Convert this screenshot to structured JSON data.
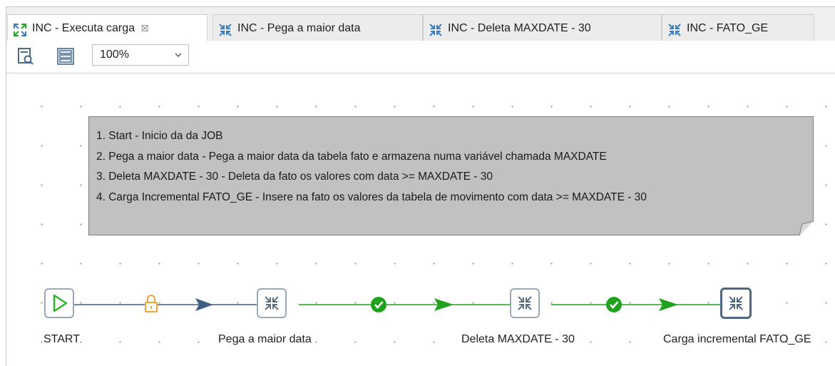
{
  "tabs": [
    {
      "label": "INC - Executa carga",
      "icon": "job-icon",
      "active": true
    },
    {
      "label": "INC - Pega a maior data",
      "icon": "transformation-icon",
      "active": false
    },
    {
      "label": "INC - Deleta MAXDATE - 30",
      "icon": "transformation-icon",
      "active": false
    },
    {
      "label": "INC - FATO_GE",
      "icon": "transformation-icon",
      "active": false
    }
  ],
  "toolbar": {
    "zoom_value": "100%",
    "buttons": [
      "preview-icon",
      "grid-icon"
    ]
  },
  "note": {
    "lines": [
      "1. Start - Inicio da da JOB",
      "2. Pega a maior data - Pega a maior data da tabela fato e armazena numa variável chamada MAXDATE",
      "3. Deleta MAXDATE - 30 - Deleta da fato os valores com data >= MAXDATE - 30",
      "4. Carga Incremental FATO_GE - Insere na fato os valores da tabela de movimento com data >= MAXDATE - 30"
    ]
  },
  "flow": {
    "nodes": [
      {
        "label": "START",
        "icon": "start-icon"
      },
      {
        "label": "Pega a maior data",
        "icon": "transformation-icon"
      },
      {
        "label": "Deleta MAXDATE - 30",
        "icon": "transformation-icon"
      },
      {
        "label": "Carga incremental FATO_GE",
        "icon": "transformation-icon",
        "selected": true
      }
    ],
    "hops": [
      {
        "from": "START",
        "to": "Pega a maior data",
        "type": "unconditional",
        "icon": "lock-icon",
        "color": "#3f5f82"
      },
      {
        "from": "Pega a maior data",
        "to": "Deleta MAXDATE - 30",
        "type": "success",
        "icon": "check-icon",
        "color": "#1fa31f"
      },
      {
        "from": "Deleta MAXDATE - 30",
        "to": "Carga incremental FATO_GE",
        "type": "success",
        "icon": "check-icon",
        "color": "#1fa31f"
      }
    ]
  },
  "colors": {
    "note_bg": "#c1c1c1",
    "hop_unconditional": "#3f5f82",
    "hop_success": "#1fa31f",
    "lock": "#f2a33a",
    "start_green": "#2db52d"
  }
}
